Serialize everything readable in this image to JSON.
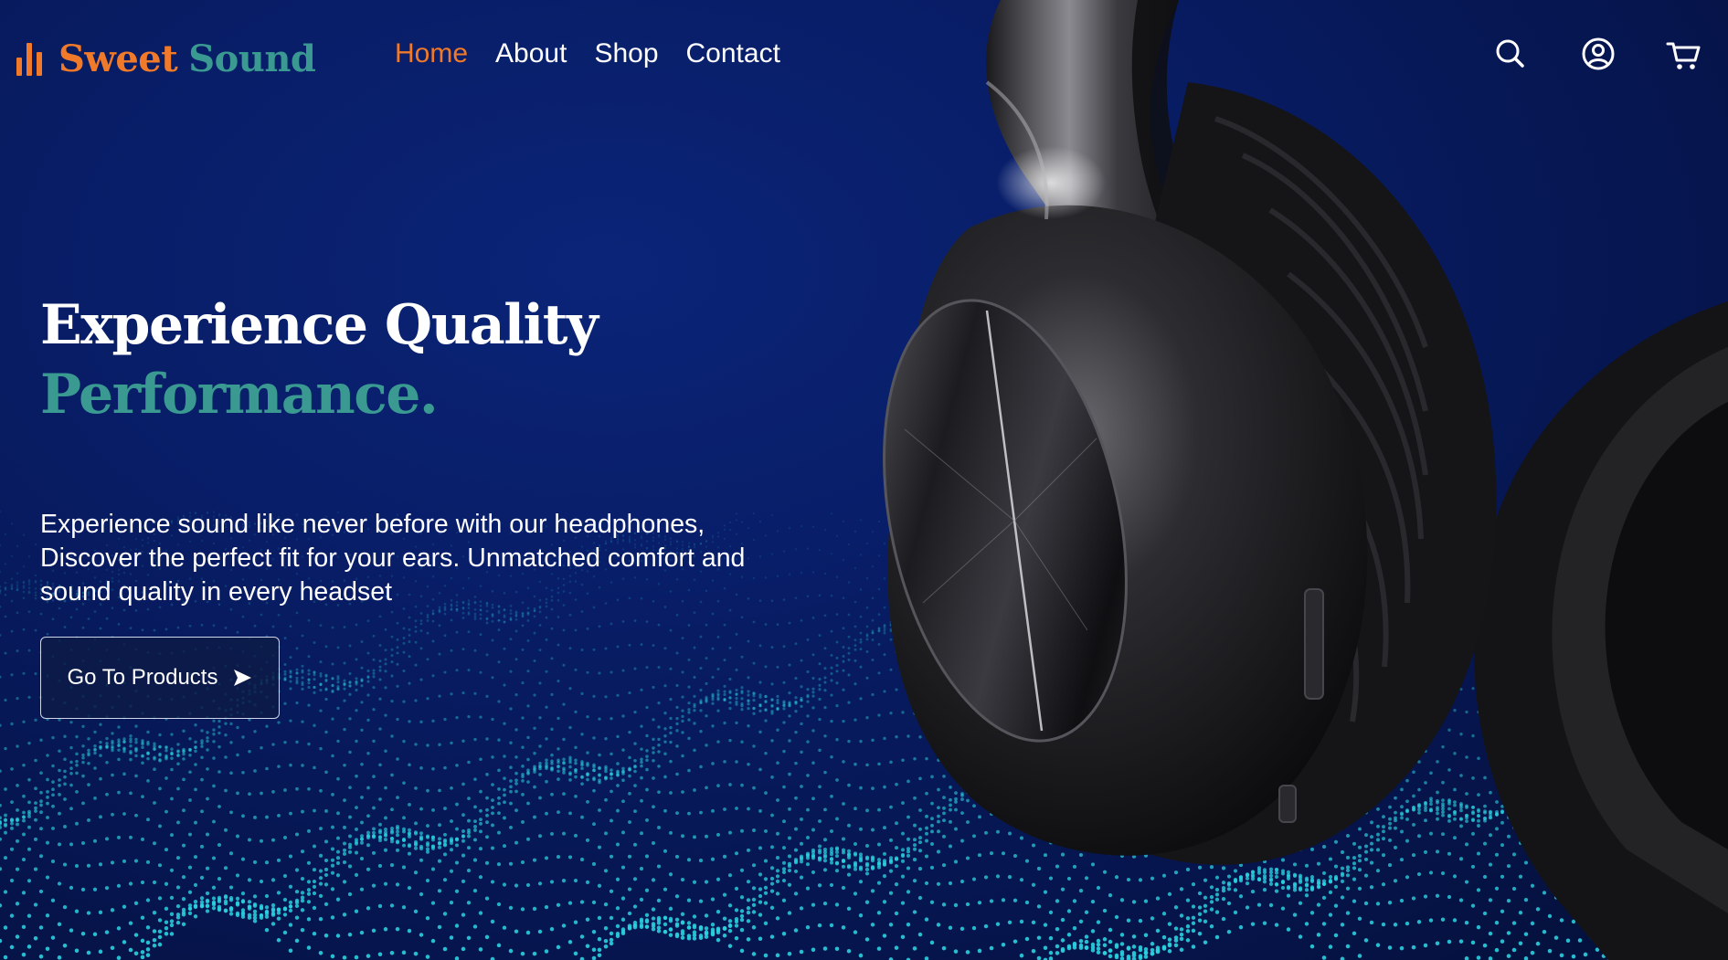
{
  "brand": {
    "name_part1": "Sweet",
    "name_part2": "Sound",
    "icon": "equalizer-bars-icon",
    "accent_color": "#f07a2a",
    "teal_color": "#3a9a92"
  },
  "nav": {
    "items": [
      {
        "label": "Home",
        "active": true
      },
      {
        "label": "About",
        "active": false
      },
      {
        "label": "Shop",
        "active": false
      },
      {
        "label": "Contact",
        "active": false
      }
    ]
  },
  "header_icons": [
    "search-icon",
    "user-account-icon",
    "cart-icon"
  ],
  "hero": {
    "title_line1": "Experience Quality",
    "title_line2": "Performance.",
    "description": "Experience sound like never before with our headphones, Discover the perfect fit for your ears. Unmatched comfort and sound quality in every headset",
    "cta_label": "Go To Products",
    "cta_icon": "send-arrow-icon"
  },
  "colors": {
    "background": "#071a5c",
    "wave_dots": "#2ad0e0",
    "text": "#ffffff"
  }
}
